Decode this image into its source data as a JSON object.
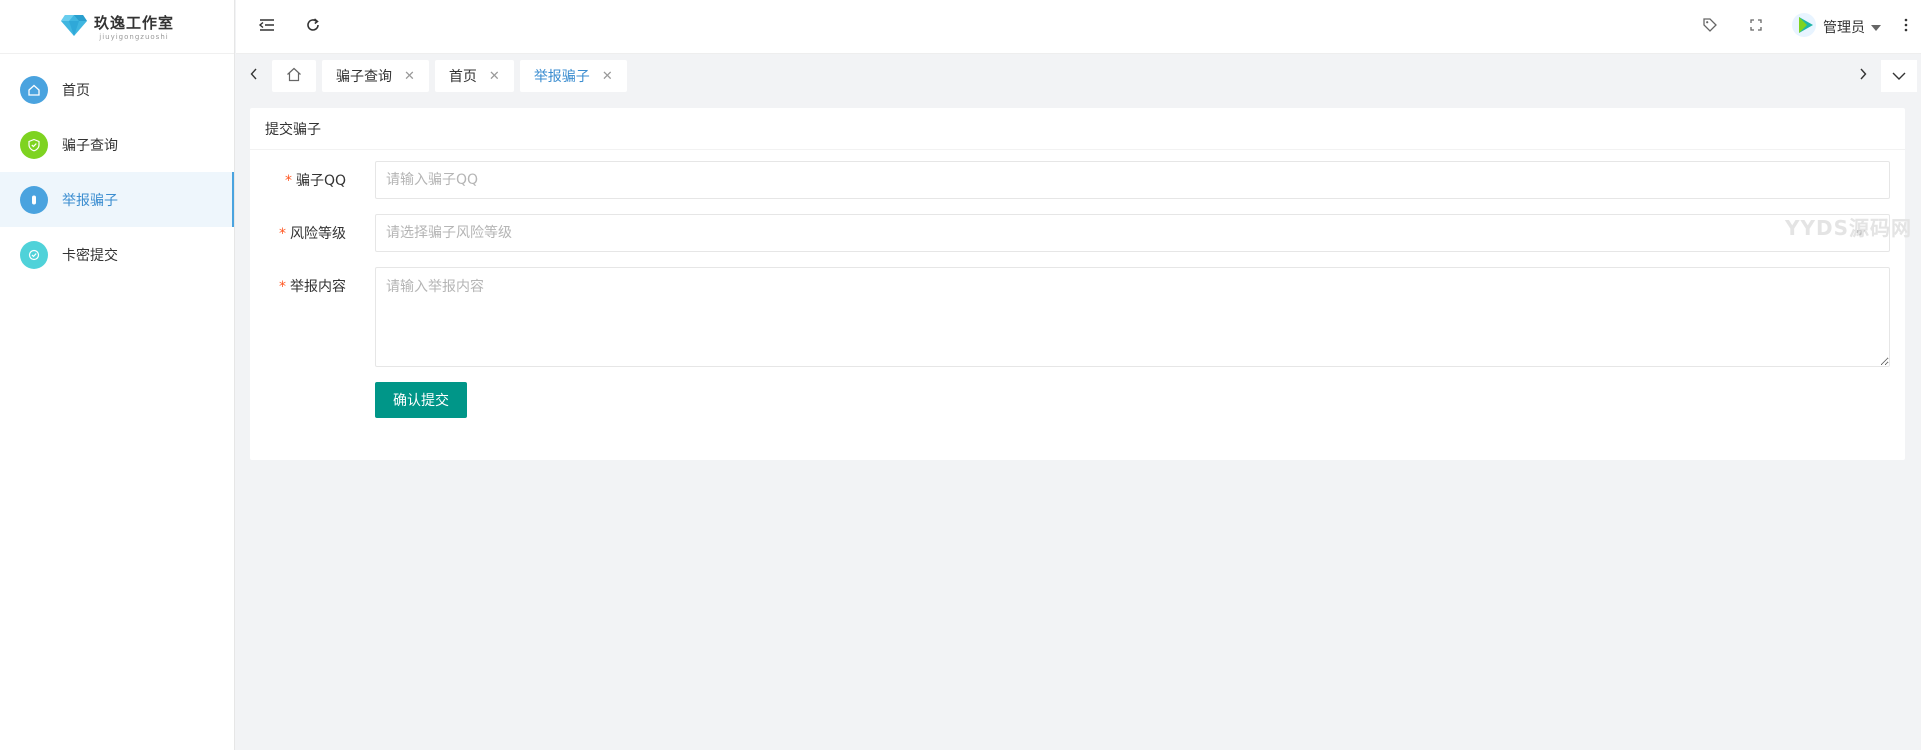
{
  "app": {
    "logo_title": "玖逸工作室",
    "logo_subtitle": "jiuyigongzuoshi"
  },
  "sidebar": {
    "items": [
      {
        "label": "首页",
        "icon": "home-icon",
        "color": "#4aa3df",
        "active": false
      },
      {
        "label": "骗子查询",
        "icon": "shield-check-icon",
        "color": "#7ed321",
        "active": false
      },
      {
        "label": "举报骗子",
        "icon": "report-icon",
        "color": "#4aa3df",
        "active": true
      },
      {
        "label": "卡密提交",
        "icon": "card-icon",
        "color": "#50d2d9",
        "active": false
      }
    ]
  },
  "header": {
    "user_name": "管理员"
  },
  "tabs": [
    {
      "label": "骗子查询",
      "active": false
    },
    {
      "label": "首页",
      "active": false
    },
    {
      "label": "举报骗子",
      "active": true
    }
  ],
  "form": {
    "title": "提交骗子",
    "fields": [
      {
        "label": "骗子QQ",
        "placeholder": "请输入骗子QQ",
        "required": true
      },
      {
        "label": "风险等级",
        "placeholder": "请选择骗子风险等级",
        "required": true
      },
      {
        "label": "举报内容",
        "placeholder": "请输入举报内容",
        "required": true
      }
    ],
    "submit_label": "确认提交"
  },
  "watermark": "YYDS源码网",
  "colors": {
    "accent": "#009688",
    "active_text": "#3b8dd0",
    "required": "#ff5722"
  }
}
